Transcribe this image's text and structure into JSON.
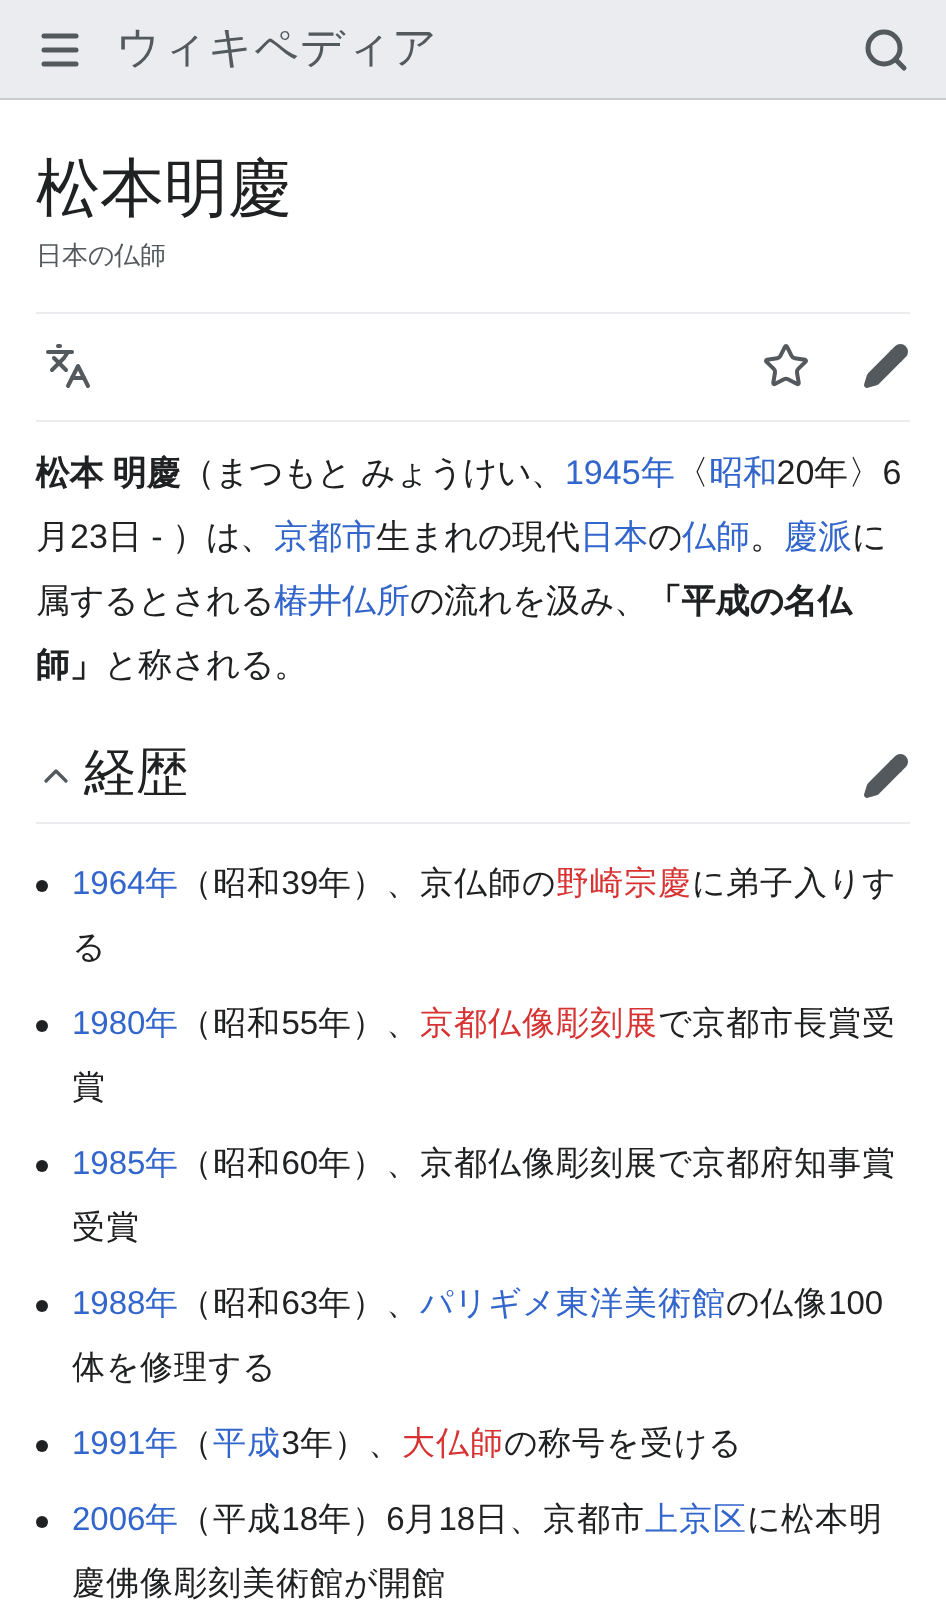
{
  "header": {
    "logo": "ウィキペディア"
  },
  "page": {
    "title": "松本明慶",
    "description": "日本の仏師",
    "watched": false
  },
  "lead": [
    {
      "kind": "bold",
      "text": "松本 明慶"
    },
    {
      "kind": "plain",
      "text": "（まつもと みょうけい、"
    },
    {
      "kind": "link",
      "text": "1945年"
    },
    {
      "kind": "plain",
      "text": "〈"
    },
    {
      "kind": "link",
      "text": "昭和"
    },
    {
      "kind": "plain",
      "text": "20年〉6月23日 - ）は、"
    },
    {
      "kind": "link",
      "text": "京都市"
    },
    {
      "kind": "plain",
      "text": "生まれの現代"
    },
    {
      "kind": "link",
      "text": "日本"
    },
    {
      "kind": "plain",
      "text": "の"
    },
    {
      "kind": "link",
      "text": "仏師"
    },
    {
      "kind": "plain",
      "text": "。"
    },
    {
      "kind": "link",
      "text": "慶派"
    },
    {
      "kind": "plain",
      "text": "に属するとされる"
    },
    {
      "kind": "link",
      "text": "椿井仏所"
    },
    {
      "kind": "plain",
      "text": "の流れを汲み、"
    },
    {
      "kind": "bold",
      "text": "「平成の名仏師」"
    },
    {
      "kind": "plain",
      "text": "と称される。"
    }
  ],
  "section": {
    "title": "経歴",
    "expanded": true,
    "items": [
      [
        {
          "kind": "link",
          "text": "1964年"
        },
        {
          "kind": "plain",
          "text": "（昭和39年）、京仏師の"
        },
        {
          "kind": "new",
          "text": "野崎宗慶"
        },
        {
          "kind": "plain",
          "text": "に弟子入りする"
        }
      ],
      [
        {
          "kind": "link",
          "text": "1980年"
        },
        {
          "kind": "plain",
          "text": "（昭和55年）、"
        },
        {
          "kind": "new",
          "text": "京都仏像彫刻展"
        },
        {
          "kind": "plain",
          "text": "で京都市長賞受賞"
        }
      ],
      [
        {
          "kind": "link",
          "text": "1985年"
        },
        {
          "kind": "plain",
          "text": "（昭和60年）、京都仏像彫刻展で京都府知事賞受賞"
        }
      ],
      [
        {
          "kind": "link",
          "text": "1988年"
        },
        {
          "kind": "plain",
          "text": "（昭和63年）、"
        },
        {
          "kind": "link",
          "text": "パリギメ東洋美術館"
        },
        {
          "kind": "plain",
          "text": "の仏像100体を修理する"
        }
      ],
      [
        {
          "kind": "link",
          "text": "1991年"
        },
        {
          "kind": "plain",
          "text": "（"
        },
        {
          "kind": "link",
          "text": "平成"
        },
        {
          "kind": "plain",
          "text": "3年）、"
        },
        {
          "kind": "new",
          "text": "大仏師"
        },
        {
          "kind": "plain",
          "text": "の称号を受ける"
        }
      ],
      [
        {
          "kind": "link",
          "text": "2006年"
        },
        {
          "kind": "plain",
          "text": "（平成18年）6月18日、京都市"
        },
        {
          "kind": "link",
          "text": "上京区"
        },
        {
          "kind": "plain",
          "text": "に松本明慶佛像彫刻美術館が開館"
        }
      ]
    ]
  }
}
